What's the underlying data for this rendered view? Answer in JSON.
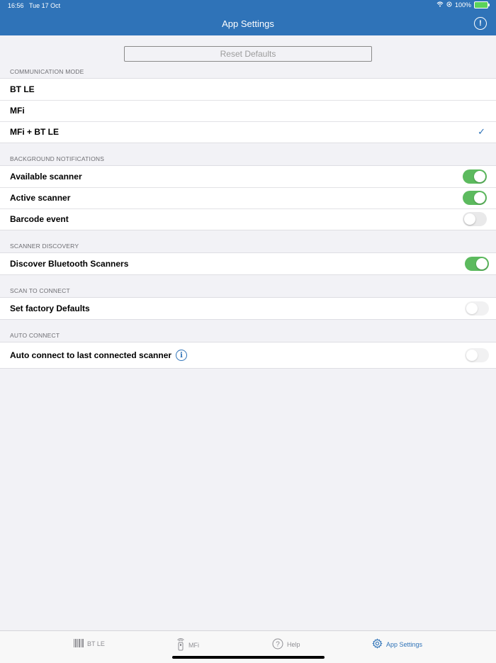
{
  "status": {
    "time": "16:56",
    "date": "Tue 17 Oct",
    "battery": "100%"
  },
  "header": {
    "title": "App Settings"
  },
  "reset": {
    "label": "Reset Defaults"
  },
  "sections": {
    "communication": {
      "header": "COMMUNICATION MODE",
      "items": [
        "BT LE",
        "MFi",
        "MFi + BT LE"
      ],
      "selected": "MFi + BT LE"
    },
    "notifications": {
      "header": "BACKGROUND NOTIFICATIONS",
      "items": [
        {
          "label": "Available scanner",
          "on": true
        },
        {
          "label": "Active scanner",
          "on": true
        },
        {
          "label": "Barcode event",
          "on": false
        }
      ]
    },
    "discovery": {
      "header": "SCANNER DISCOVERY",
      "items": [
        {
          "label": "Discover Bluetooth Scanners",
          "on": true
        }
      ]
    },
    "scan_connect": {
      "header": "SCAN TO CONNECT",
      "items": [
        {
          "label": "Set factory Defaults",
          "on": false
        }
      ]
    },
    "auto_connect": {
      "header": "AUTO CONNECT",
      "items": [
        {
          "label": "Auto connect to last connected scanner",
          "on": false
        }
      ]
    }
  },
  "tabs": [
    {
      "label": "BT LE",
      "icon": "barcode-icon",
      "active": false
    },
    {
      "label": "MFi",
      "icon": "scanner-icon",
      "active": false
    },
    {
      "label": "Help",
      "icon": "help-icon",
      "active": false
    },
    {
      "label": "App Settings",
      "icon": "gear-icon",
      "active": true
    }
  ],
  "colors": {
    "accent": "#2f73b8",
    "toggle_on": "#5cba5e",
    "background": "#f2f2f6"
  }
}
